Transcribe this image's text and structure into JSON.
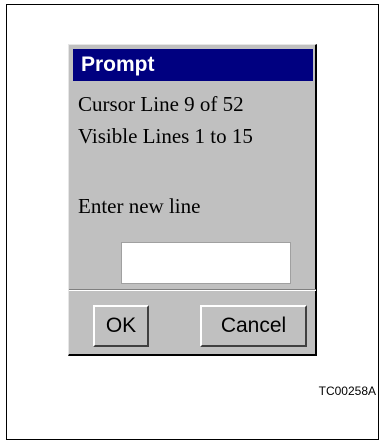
{
  "dialog": {
    "title": "Prompt",
    "cursor_line": "Cursor Line 9 of 52",
    "visible_lines": "Visible Lines 1 to 15",
    "prompt_label": "Enter new line",
    "input_value": "",
    "ok_label": "OK",
    "cancel_label": "Cancel"
  },
  "figure_ref": "TC00258A",
  "colors": {
    "titlebar": "#000080",
    "dialog_bg": "#c0c0c0"
  }
}
